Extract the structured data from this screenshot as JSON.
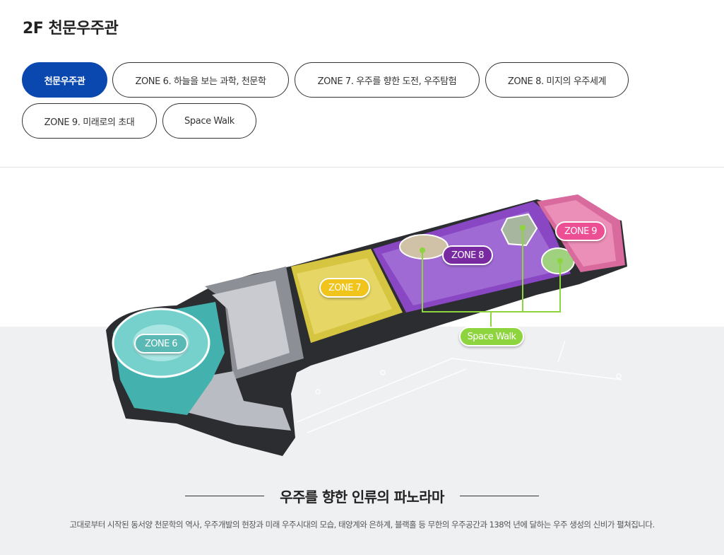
{
  "page": {
    "title": "2F 천문우주관"
  },
  "tabs": [
    {
      "label": "천문우주관",
      "active": true
    },
    {
      "label": "ZONE 6. 하늘을 보는 과학, 천문학",
      "active": false
    },
    {
      "label": "ZONE 7. 우주를 향한 도전, 우주탐험",
      "active": false
    },
    {
      "label": "ZONE 8. 미지의 우주세계",
      "active": false
    },
    {
      "label": "ZONE 9. 미래로의 초대",
      "active": false
    },
    {
      "label": "Space Walk",
      "active": false
    }
  ],
  "map": {
    "zones": [
      {
        "label": "ZONE 6",
        "color": "#5bb9b5"
      },
      {
        "label": "ZONE 7",
        "color": "#f0c41b"
      },
      {
        "label": "ZONE 8",
        "color": "#7a2aa0"
      },
      {
        "label": "ZONE 9",
        "color": "#ec4f94"
      },
      {
        "label": "Space Walk",
        "color": "#8ed43f"
      }
    ]
  },
  "section": {
    "heading": "우주를 향한 인류의 파노라마",
    "description": "고대로부터 시작된 동서양 천문학의 역사, 우주개발의 현장과 미래 우주시대의 모습, 태양계와 은하계, 블랙홀 등 무한의 우주공간과 138억 년에 달하는 우주 생성의 신비가 펼쳐집니다."
  },
  "colors": {
    "active_tab": "#0a48b0",
    "page_bg_lower": "#eff0f2"
  }
}
